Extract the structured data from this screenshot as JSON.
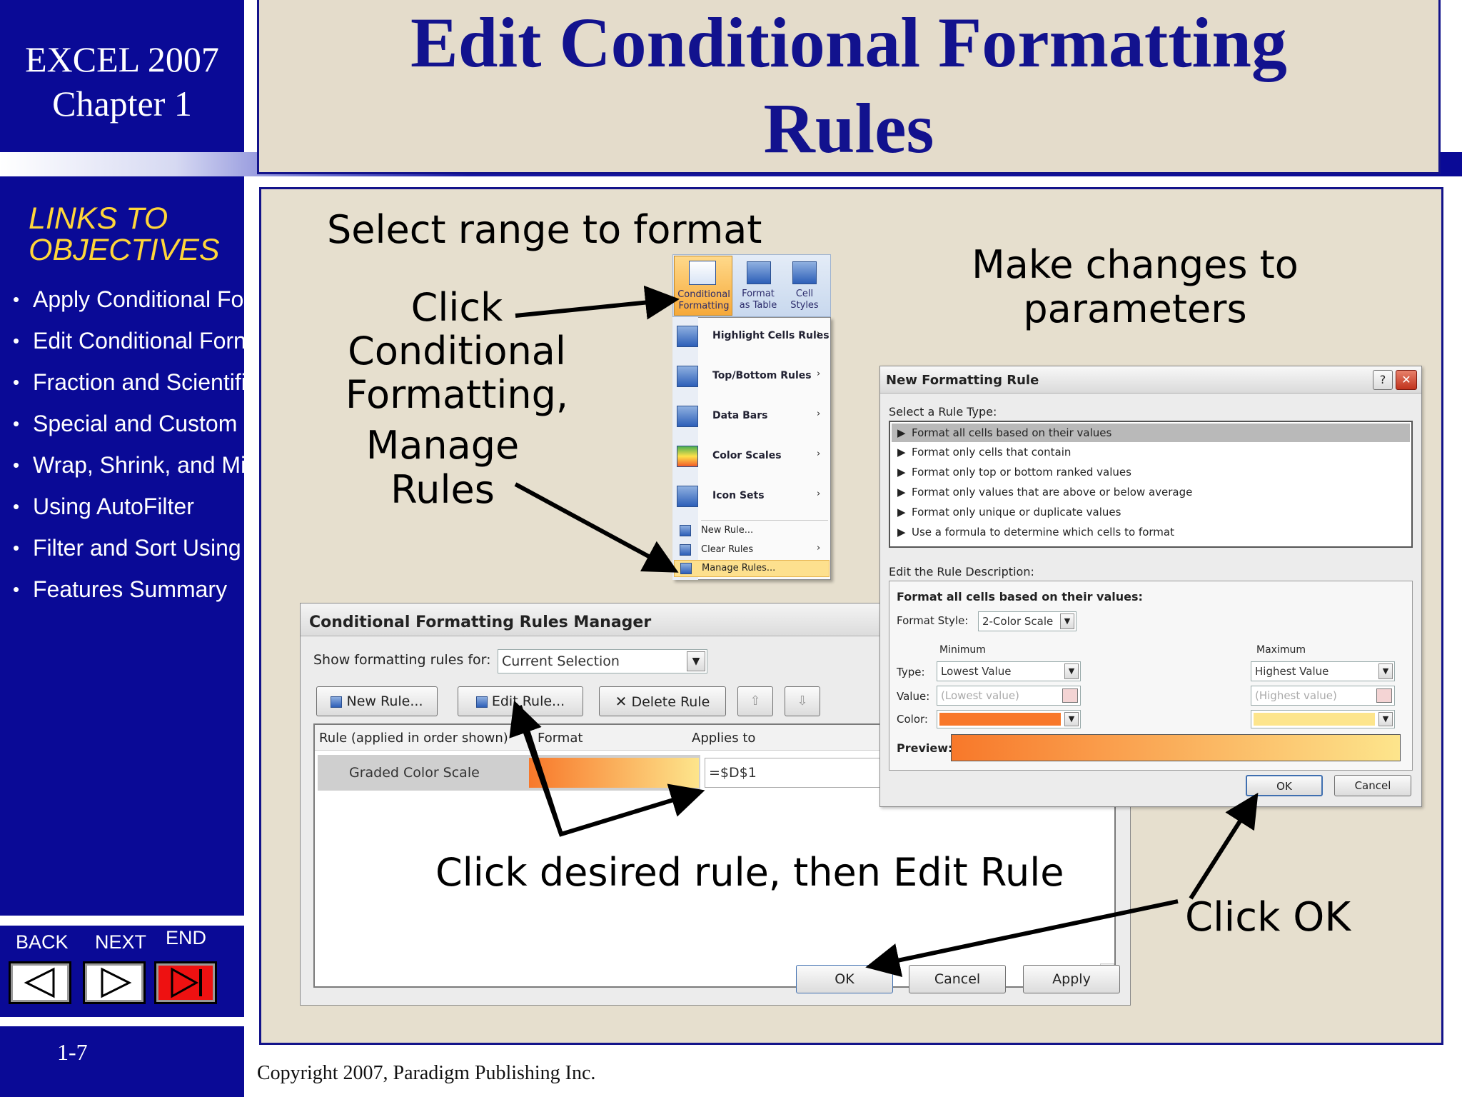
{
  "header": {
    "course": "EXCEL 2007",
    "chapter": "Chapter 1",
    "title_line1": "Edit Conditional Formatting",
    "title_line2": "Rules"
  },
  "sidebar": {
    "links_title_1": "LINKS TO",
    "links_title_2": "OBJECTIVES",
    "items": [
      {
        "label": "Apply Conditional Fo"
      },
      {
        "label": "Edit Conditional Forn"
      },
      {
        "label": "Fraction and Scientifi"
      },
      {
        "label": "Special and Custom"
      },
      {
        "label": "Wrap, Shrink, and Mi"
      },
      {
        "label": "Using AutoFilter"
      },
      {
        "label": "Filter and Sort Using"
      },
      {
        "label": "Features Summary"
      }
    ],
    "nav": {
      "back": "BACK",
      "next": "NEXT",
      "end": "END"
    },
    "page_number": "1-7"
  },
  "footer": {
    "copyright": "Copyright 2007, Paradigm Publishing Inc."
  },
  "callouts": {
    "select_range": "Select range to format",
    "click_cf_1": "Click",
    "click_cf_2": "Conditional",
    "click_cf_3": "Formatting,",
    "click_cf_4": "Manage",
    "click_cf_5": "Rules",
    "make_changes_1": "Make changes to",
    "make_changes_2": "parameters",
    "click_rule": "Click desired rule, then Edit Rule",
    "click_ok": "Click OK"
  },
  "ribbon": {
    "cf_1": "Conditional",
    "cf_2": "Formatting",
    "ft_1": "Format",
    "ft_2": "as Table",
    "cs_1": "Cell",
    "cs_2": "Styles",
    "menu": [
      {
        "label": "Highlight Cells Rules",
        "submenu": true
      },
      {
        "label": "Top/Bottom Rules",
        "submenu": true
      },
      {
        "label": "Data Bars",
        "submenu": true
      },
      {
        "label": "Color Scales",
        "submenu": true
      },
      {
        "label": "Icon Sets",
        "submenu": true
      }
    ],
    "menu_small": [
      {
        "label": "New Rule...",
        "submenu": false
      },
      {
        "label": "Clear Rules",
        "submenu": true
      },
      {
        "label": "Manage Rules...",
        "submenu": false
      }
    ]
  },
  "rules_manager": {
    "title": "Conditional Formatting Rules Manager",
    "show_label": "Show formatting rules for:",
    "show_value": "Current Selection",
    "new_rule": "New Rule...",
    "edit_rule": "Edit Rule...",
    "delete_rule": "Delete Rule",
    "col_rule": "Rule (applied in order shown)",
    "col_format": "Format",
    "col_applies": "Applies to",
    "row_rule": "Graded Color Scale",
    "row_applies": "=$D$1",
    "ok": "OK",
    "cancel": "Cancel",
    "apply": "Apply"
  },
  "new_rule_dialog": {
    "title": "New Formatting Rule",
    "select_type_label": "Select a Rule Type:",
    "types": [
      {
        "label": "Format all cells based on their values"
      },
      {
        "label": "Format only cells that contain"
      },
      {
        "label": "Format only top or bottom ranked values"
      },
      {
        "label": "Format only values that are above or below average"
      },
      {
        "label": "Format only unique or duplicate values"
      },
      {
        "label": "Use a formula to determine which cells to format"
      }
    ],
    "edit_desc_label": "Edit the Rule Description:",
    "format_all_label": "Format all cells based on their values:",
    "format_style_label": "Format Style:",
    "format_style_value": "2-Color Scale",
    "minimum": "Minimum",
    "maximum": "Maximum",
    "type_label": "Type:",
    "value_label": "Value:",
    "color_label": "Color:",
    "min_type": "Lowest Value",
    "max_type": "Highest Value",
    "min_value": "(Lowest value)",
    "max_value": "(Highest value)",
    "preview_label": "Preview:",
    "min_color": "#f8782a",
    "max_color": "#fde58c",
    "ok": "OK",
    "cancel": "Cancel"
  }
}
